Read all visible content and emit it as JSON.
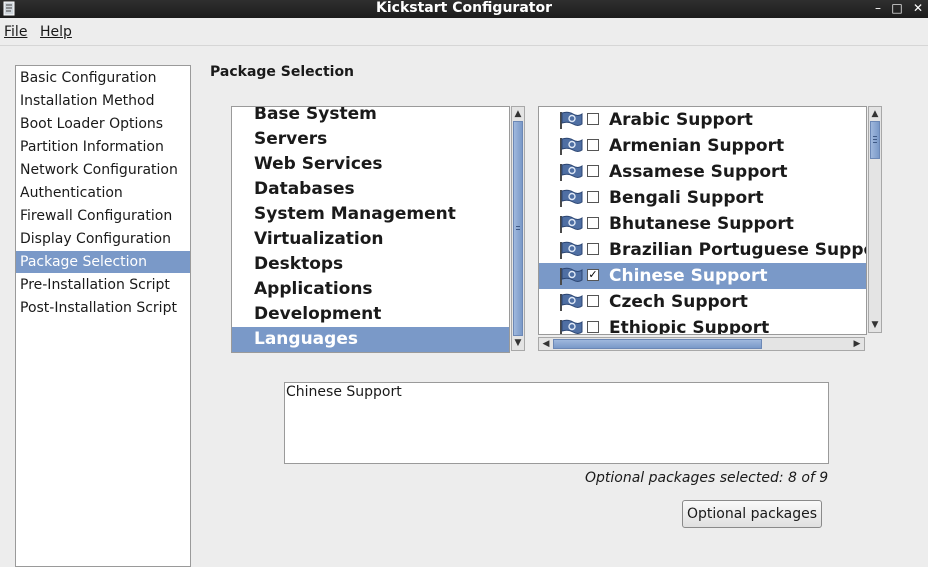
{
  "window": {
    "title": "Kickstart Configurator",
    "controls": {
      "minimize": "–",
      "maximize": "□",
      "close": "✕"
    }
  },
  "menubar": {
    "file": "File",
    "help": "Help"
  },
  "sidebar": {
    "items": [
      {
        "label": "Basic Configuration"
      },
      {
        "label": "Installation Method"
      },
      {
        "label": "Boot Loader Options"
      },
      {
        "label": "Partition Information"
      },
      {
        "label": "Network Configuration"
      },
      {
        "label": "Authentication"
      },
      {
        "label": "Firewall Configuration"
      },
      {
        "label": "Display Configuration"
      },
      {
        "label": "Package Selection"
      },
      {
        "label": "Pre-Installation Script"
      },
      {
        "label": "Post-Installation Script"
      }
    ],
    "selected": "Package Selection"
  },
  "main": {
    "heading": "Package Selection",
    "groups": [
      "Base System",
      "Servers",
      "Web Services",
      "Databases",
      "System Management",
      "Virtualization",
      "Desktops",
      "Applications",
      "Development",
      "Languages"
    ],
    "selected_group": "Languages",
    "packages": [
      {
        "label": "Arabic Support",
        "checked": false
      },
      {
        "label": "Armenian Support",
        "checked": false
      },
      {
        "label": "Assamese Support",
        "checked": false
      },
      {
        "label": "Bengali Support",
        "checked": false
      },
      {
        "label": "Bhutanese Support",
        "checked": false
      },
      {
        "label": "Brazilian Portuguese Support",
        "checked": false
      },
      {
        "label": "Chinese Support",
        "checked": true
      },
      {
        "label": "Czech Support",
        "checked": false
      },
      {
        "label": "Ethiopic Support",
        "checked": false
      }
    ],
    "selected_package": "Chinese Support",
    "description": "Chinese Support",
    "status": "Optional packages selected: 8 of 9",
    "optional_button": "Optional packages"
  },
  "colors": {
    "selection": "#7a99c8",
    "titlebar": "#262626"
  },
  "icons": {
    "app": "app-icon",
    "flag": "language-flag-icon"
  }
}
